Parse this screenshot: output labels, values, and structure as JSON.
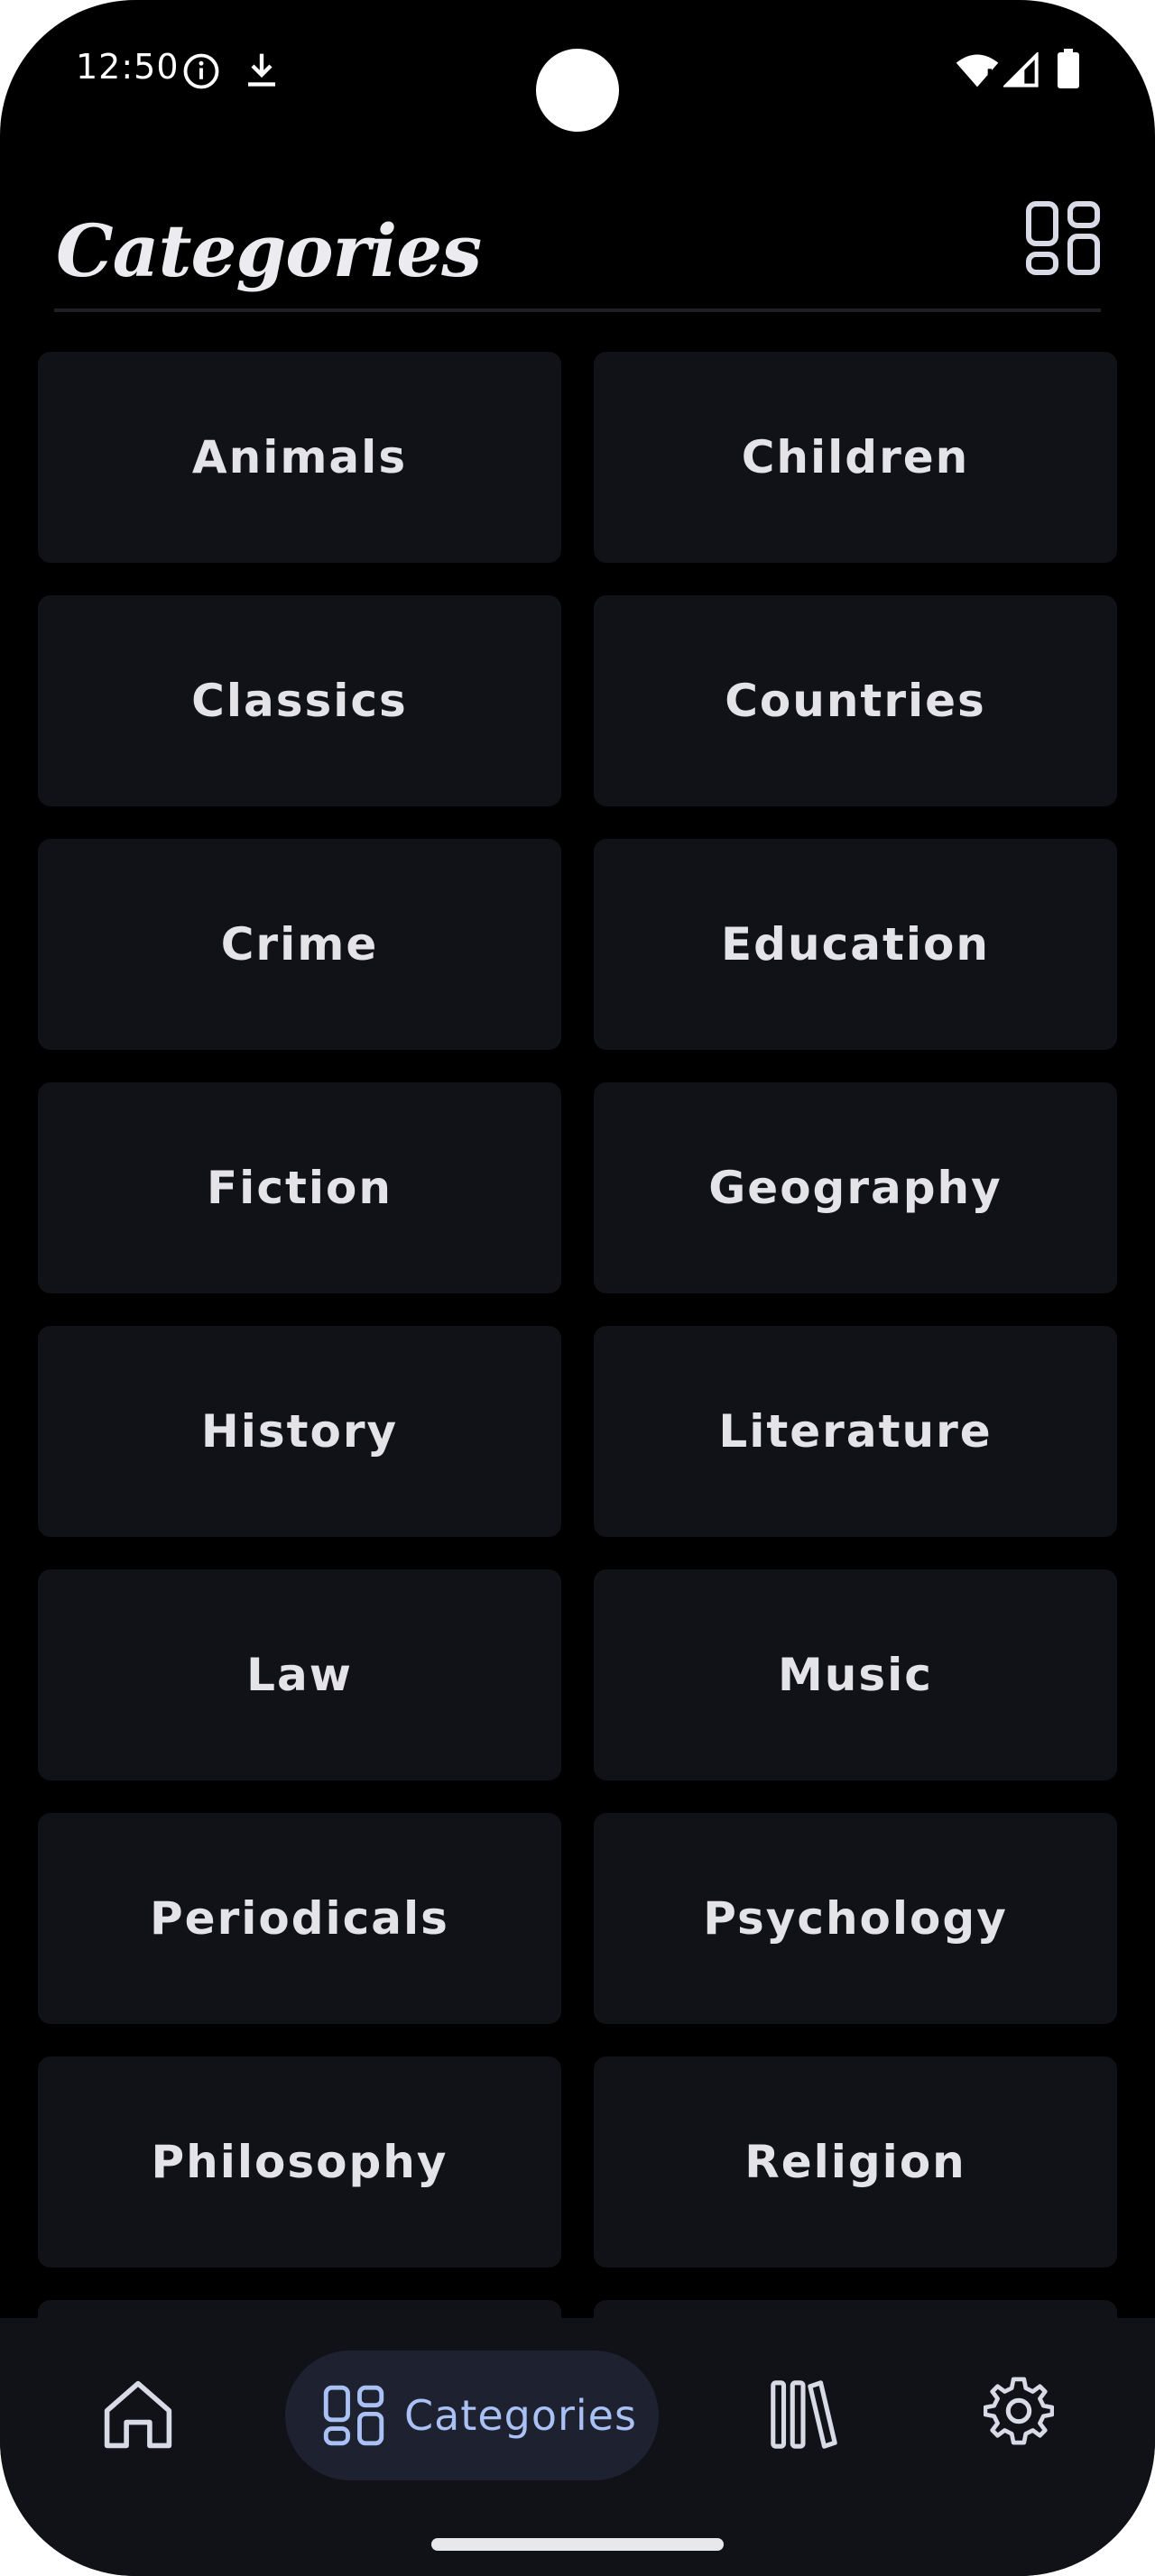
{
  "status_bar": {
    "time": "12:50",
    "icons": [
      "info-icon",
      "download-icon",
      "wifi-icon",
      "signal-icon",
      "battery-icon"
    ]
  },
  "header": {
    "title": "Categories",
    "grid_toggle_icon": "grid-view-icon"
  },
  "categories": [
    "Animals",
    "Children",
    "Classics",
    "Countries",
    "Crime",
    "Education",
    "Fiction",
    "Geography",
    "History",
    "Literature",
    "Law",
    "Music",
    "Periodicals",
    "Psychology",
    "Philosophy",
    "Religion",
    "",
    ""
  ],
  "bottom_nav": {
    "items": [
      {
        "icon": "home-icon",
        "label": "",
        "active": false
      },
      {
        "icon": "categories-icon",
        "label": "Categories",
        "active": true
      },
      {
        "icon": "library-icon",
        "label": "",
        "active": false
      },
      {
        "icon": "settings-icon",
        "label": "",
        "active": false
      }
    ]
  },
  "colors": {
    "background": "#000000",
    "card": "#111217",
    "text": "#e3e3e8",
    "nav_background": "#111217",
    "nav_active_pill": "#1e2130",
    "accent": "#a9c1f4"
  }
}
